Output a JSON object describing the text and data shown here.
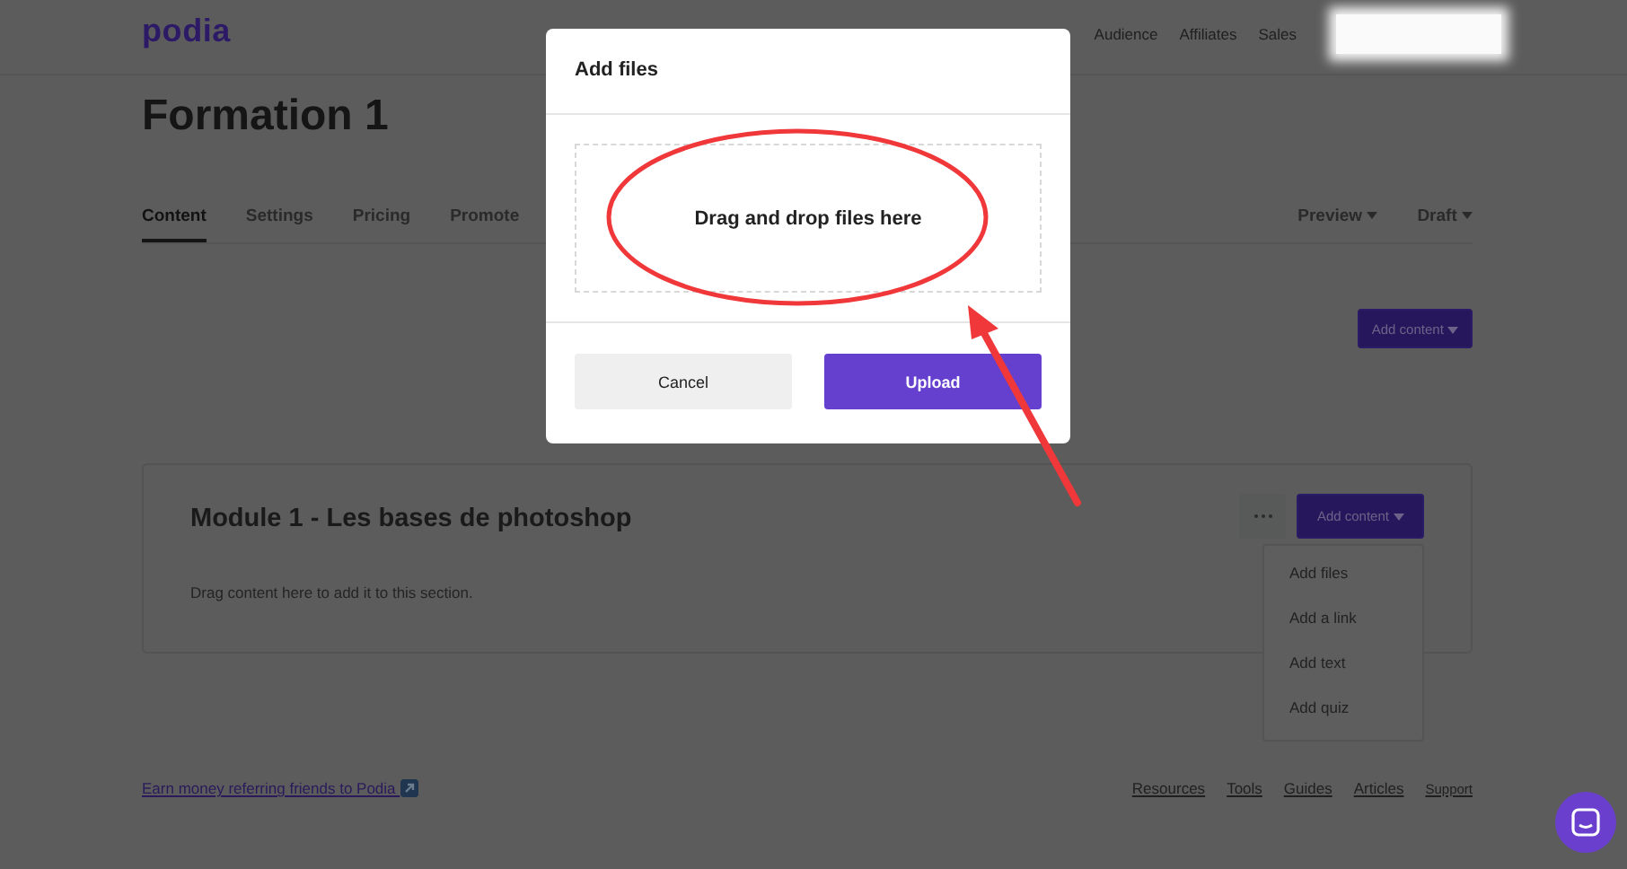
{
  "header": {
    "logo": "podia",
    "nav": [
      "Audience",
      "Affiliates",
      "Sales"
    ]
  },
  "page_title": "Formation 1",
  "tabs": [
    {
      "label": "Content",
      "selected": true
    },
    {
      "label": "Settings",
      "selected": false
    },
    {
      "label": "Pricing",
      "selected": false
    },
    {
      "label": "Promote",
      "selected": false
    }
  ],
  "tab_menus": [
    "Preview",
    "Draft"
  ],
  "add_content_button": "Add content",
  "module": {
    "title": "Module 1 - Les bases de photoshop",
    "hint": "Drag content here to add it to this section.",
    "add_content_button": "Add content",
    "menu": [
      "Add files",
      "Add a link",
      "Add text",
      "Add quiz"
    ]
  },
  "footer": {
    "referral_link": "Earn money referring friends to Podia",
    "links": [
      "Resources",
      "Tools",
      "Guides",
      "Articles",
      "Support"
    ]
  },
  "modal": {
    "title": "Add files",
    "dropzone": "Drag and drop files here",
    "buttons": [
      {
        "label": "Cancel",
        "kind": "secondary"
      },
      {
        "label": "Upload",
        "kind": "primary"
      }
    ]
  }
}
